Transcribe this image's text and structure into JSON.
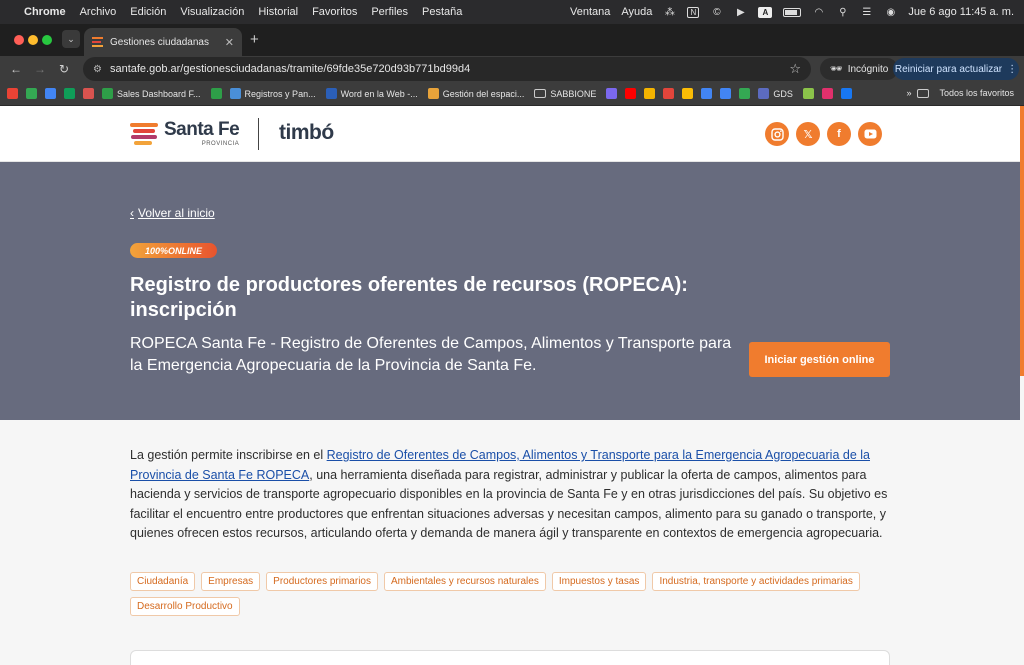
{
  "menubar": {
    "app": "Chrome",
    "items": [
      "Archivo",
      "Edición",
      "Visualización",
      "Historial",
      "Favoritos",
      "Perfiles",
      "Pestaña"
    ],
    "right_items": [
      "Ventana",
      "Ayuda"
    ],
    "clock": "Jue 6 ago  11:45 a. m."
  },
  "browser": {
    "tab_title": "Gestiones ciudadanas",
    "url": "santafe.gob.ar/gestionesciudadanas/tramite/69fde35e720d93b771bd99d4",
    "incognito_label": "Incógnito",
    "update_label": "Reiniciar para actualizar"
  },
  "bookmarks": {
    "items": [
      {
        "label": "Sales Dashboard F...",
        "color": "#2e9e48"
      },
      {
        "label": "Registros y Pan...",
        "color": "#4a8fd8"
      },
      {
        "label": "Word en la Web -...",
        "color": "#2b5fb8"
      },
      {
        "label": "Gestión del espaci...",
        "color": "#e8a33a"
      },
      {
        "label": "SABBIONE",
        "color": "folder"
      }
    ],
    "gds_label": "GDS",
    "all_label": "Todos los favoritos"
  },
  "site": {
    "logo_santa_fe": "Santa Fe",
    "logo_provincia": "PROVINCIA",
    "logo_timbo": "timbó",
    "socials": [
      "instagram-icon",
      "x-icon",
      "facebook-icon",
      "youtube-icon"
    ]
  },
  "hero": {
    "back_link": "Volver al inicio",
    "badge": "100%ONLINE",
    "title": "Registro de productores oferentes de recursos (ROPECA): inscripción",
    "subtitle": "ROPECA Santa Fe - Registro de Oferentes de Campos, Alimentos y Transporte para la Emergencia Agropecuaria de la Provincia de Santa Fe.",
    "cta": "Iniciar gestión online"
  },
  "content": {
    "intro_before_link": "La gestión permite inscribirse en el ",
    "link": "Registro de Oferentes de Campos, Alimentos y Transporte para la Emergencia Agropecuaria de la Provincia de Santa Fe ROPECA",
    "intro_after_link": ", una herramienta diseñada para registrar, administrar y publicar la oferta de campos, alimentos para hacienda y servicios de transporte agropecuario disponibles en la provincia de Santa Fe y en otras jurisdicciones del país. Su objetivo es facilitar el encuentro entre productores que enfrentan situaciones adversas y necesitan campos, alimento para su ganado o transporte, y quienes ofrecen estos recursos, articulando oferta y demanda de manera ágil y transparente en contextos de emergencia agropecuaria."
  },
  "tags": [
    "Ciudadanía",
    "Empresas",
    "Productores primarios",
    "Ambientales y recursos naturales",
    "Impuestos y tasas",
    "Industria, transporte y actividades primarias",
    "Desarrollo Productivo"
  ],
  "colors": {
    "brand_orange": "#f07c2e",
    "hero_bg": "#676b7e"
  }
}
